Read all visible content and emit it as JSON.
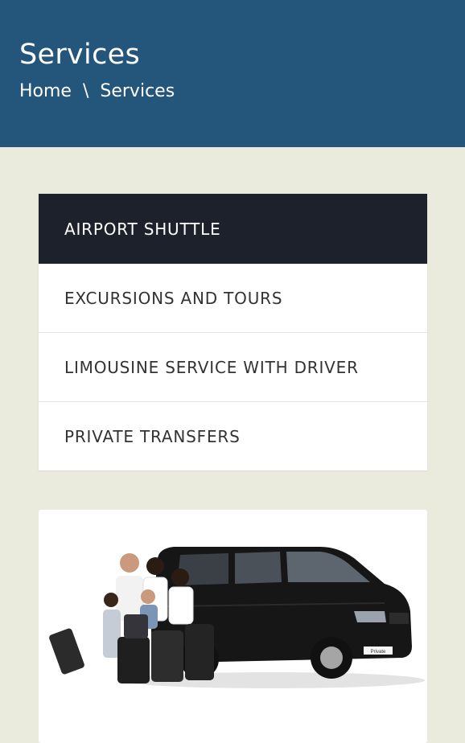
{
  "header": {
    "title": "Services",
    "breadcrumb": {
      "home": "Home",
      "separator": "\\",
      "current": "Services"
    },
    "background": "#24567c"
  },
  "menu": {
    "items": [
      {
        "label": "AIRPORT SHUTTLE",
        "active": true
      },
      {
        "label": "EXCURSIONS AND TOURS",
        "active": false
      },
      {
        "label": "LIMOUSINE SERVICE WITH DRIVER",
        "active": false
      },
      {
        "label": "PRIVATE TRANSFERS",
        "active": false
      }
    ],
    "active_color": "#1c212b"
  },
  "card": {
    "image": "family-with-luggage-and-black-van",
    "van_plate": "Private"
  },
  "colors": {
    "page_background": "#ebebdd",
    "card_background": "#ffffff"
  }
}
